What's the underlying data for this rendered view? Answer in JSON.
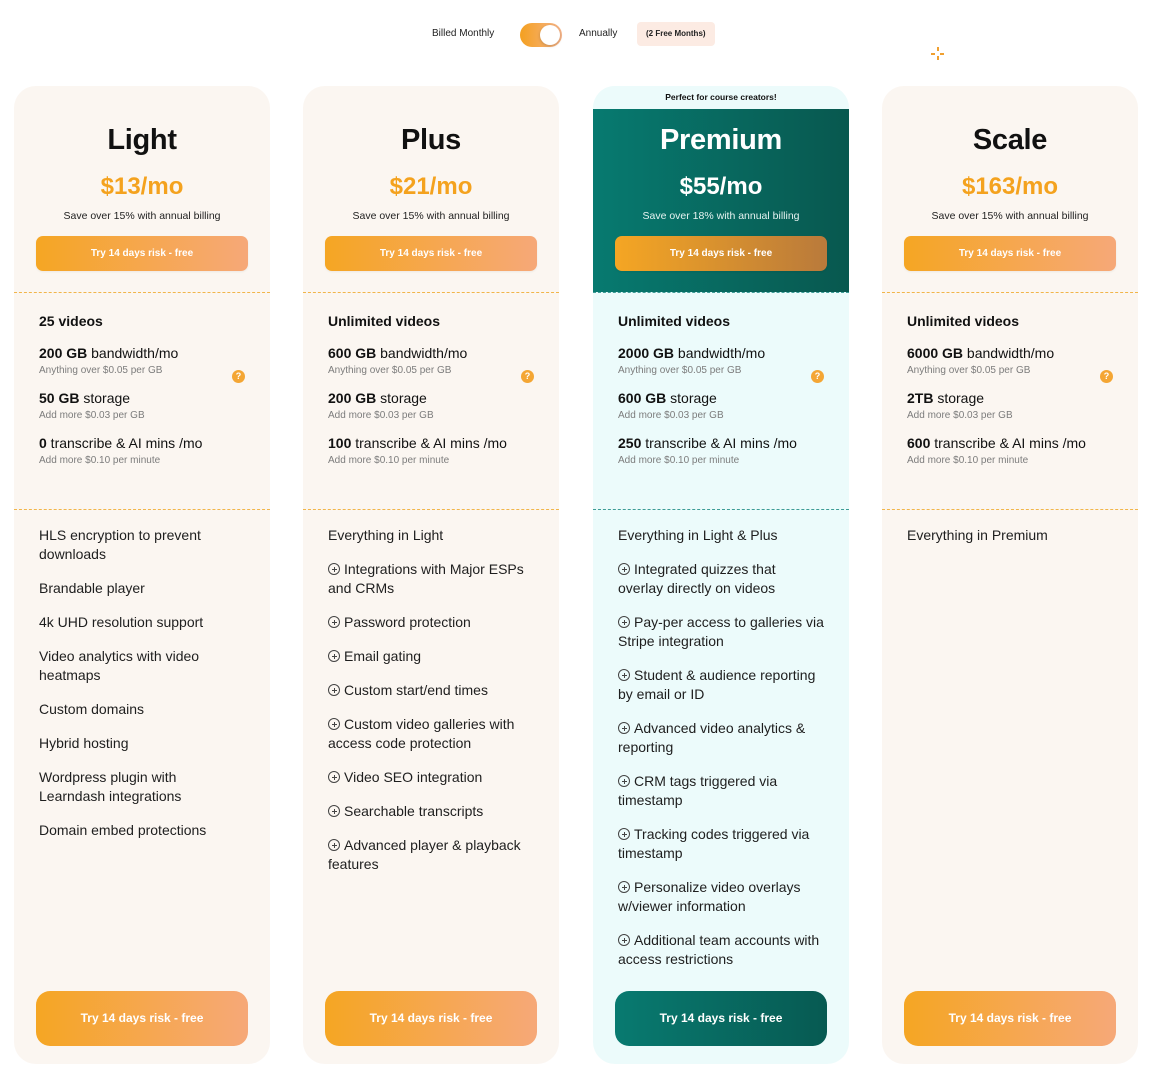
{
  "billing": {
    "monthly_label": "Billed Monthly",
    "annually_label": "Annually",
    "badge": "(2 Free Months)",
    "toggle_state": "annually"
  },
  "colors": {
    "accent_orange": "#f4a21e",
    "premium_teal": "#077a70",
    "card_bg": "#fbf6f1",
    "premium_card_bg": "#ecfbfb"
  },
  "plans": [
    {
      "name": "Light",
      "price": "$13/mo",
      "save": "Save over 15% with annual billing",
      "cta_top": "Try 14 days risk - free",
      "cta_bottom": "Try 14 days risk - free",
      "videos": "25 videos",
      "bandwidth": {
        "bold": "200 GB",
        "rest": " bandwidth/mo",
        "sub": "Anything over $0.05 per GB"
      },
      "storage": {
        "bold": "50 GB",
        "rest": " storage",
        "sub": "Add more $0.03 per GB"
      },
      "transcribe": {
        "bold": "0",
        "rest": " transcribe & AI mins /mo",
        "sub": "Add more $0.10 per minute"
      },
      "features": [
        {
          "text": "HLS encryption to prevent downloads",
          "plus": false
        },
        {
          "text": "Brandable player",
          "plus": false
        },
        {
          "text": "4k UHD resolution support",
          "plus": false
        },
        {
          "text": "Video analytics with video heatmaps",
          "plus": false
        },
        {
          "text": "Custom domains",
          "plus": false
        },
        {
          "text": "Hybrid hosting",
          "plus": false
        },
        {
          "text": "Wordpress plugin with Learndash integrations",
          "plus": false
        },
        {
          "text": "Domain embed protections",
          "plus": false
        }
      ]
    },
    {
      "name": "Plus",
      "price": "$21/mo",
      "save": "Save over 15% with annual billing",
      "cta_top": "Try 14 days risk - free",
      "cta_bottom": "Try 14 days risk - free",
      "videos": "Unlimited videos",
      "bandwidth": {
        "bold": "600 GB",
        "rest": " bandwidth/mo",
        "sub": "Anything over $0.05 per GB"
      },
      "storage": {
        "bold": "200 GB",
        "rest": " storage",
        "sub": "Add more $0.03 per GB"
      },
      "transcribe": {
        "bold": "100",
        "rest": " transcribe & AI mins /mo",
        "sub": "Add more $0.10 per minute"
      },
      "features": [
        {
          "text": "Everything in Light",
          "plus": false
        },
        {
          "text": "Integrations with Major ESPs and CRMs",
          "plus": true
        },
        {
          "text": "Password protection",
          "plus": true
        },
        {
          "text": "Email gating",
          "plus": true
        },
        {
          "text": "Custom start/end times",
          "plus": true
        },
        {
          "text": "Custom video galleries with access code protection",
          "plus": true
        },
        {
          "text": "Video SEO integration",
          "plus": true
        },
        {
          "text": "Searchable transcripts",
          "plus": true
        },
        {
          "text": "Advanced player & playback features",
          "plus": true
        }
      ]
    },
    {
      "name": "Premium",
      "ribbon": "Perfect for course creators!",
      "price": "$55/mo",
      "save": "Save over 18% with annual billing",
      "cta_top": "Try 14 days risk - free",
      "cta_bottom": "Try 14 days risk - free",
      "videos": "Unlimited videos",
      "bandwidth": {
        "bold": "2000 GB",
        "rest": " bandwidth/mo",
        "sub": "Anything over $0.05 per GB"
      },
      "storage": {
        "bold": "600 GB",
        "rest": " storage",
        "sub": "Add more $0.03 per GB"
      },
      "transcribe": {
        "bold": "250",
        "rest": " transcribe & AI mins /mo",
        "sub": "Add more $0.10 per minute"
      },
      "features": [
        {
          "text": "Everything in Light & Plus",
          "plus": false
        },
        {
          "text": "Integrated quizzes that overlay directly on videos",
          "plus": true
        },
        {
          "text": "Pay-per access to galleries via Stripe integration",
          "plus": true
        },
        {
          "text": "Student & audience reporting by email or ID",
          "plus": true
        },
        {
          "text": "Advanced video analytics & reporting",
          "plus": true
        },
        {
          "text": "CRM tags triggered via timestamp",
          "plus": true
        },
        {
          "text": "Tracking codes triggered via timestamp",
          "plus": true
        },
        {
          "text": "Personalize video overlays w/viewer information",
          "plus": true
        },
        {
          "text": "Additional team accounts with access restrictions",
          "plus": true
        }
      ]
    },
    {
      "name": "Scale",
      "price": "$163/mo",
      "save": "Save over 15% with annual billing",
      "cta_top": "Try 14 days risk - free",
      "cta_bottom": "Try 14 days risk - free",
      "videos": "Unlimited videos",
      "bandwidth": {
        "bold": "6000 GB",
        "rest": " bandwidth/mo",
        "sub": "Anything over $0.05 per GB"
      },
      "storage": {
        "bold": "2TB",
        "rest": " storage",
        "sub": "Add more $0.03 per GB"
      },
      "transcribe": {
        "bold": "600",
        "rest": " transcribe & AI mins /mo",
        "sub": "Add more $0.10 per minute"
      },
      "features": [
        {
          "text": "Everything in Premium",
          "plus": false
        }
      ]
    }
  ],
  "help_icon_glyph": "?"
}
